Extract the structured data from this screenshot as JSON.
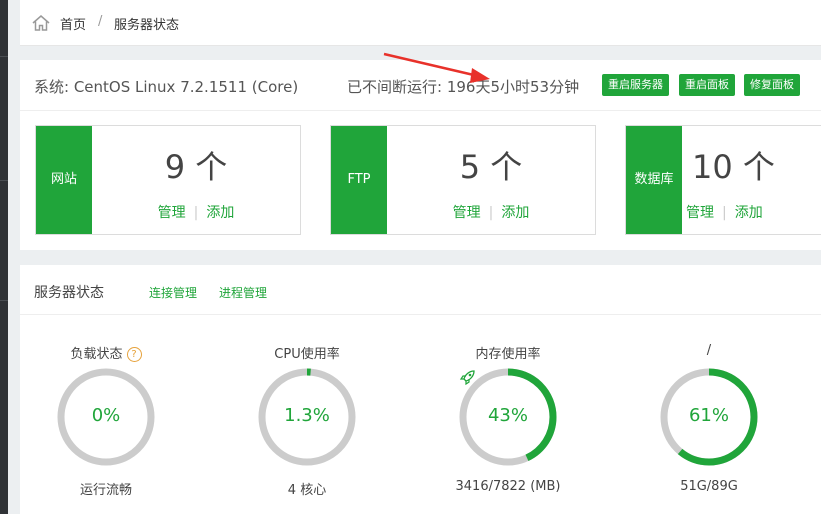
{
  "breadcrumb": {
    "home": "首页",
    "separator": "/",
    "current": "服务器状态"
  },
  "system": {
    "os_label": "系统: CentOS Linux 7.2.1511 (Core)",
    "uptime_label": "已不间断运行: 196天5小时53分钟",
    "buttons": [
      "重启服务器",
      "重启面板",
      "修复面板"
    ]
  },
  "cards": [
    {
      "tag": "网站",
      "count": "9 个",
      "manage": "管理",
      "add": "添加"
    },
    {
      "tag": "FTP",
      "count": "5 个",
      "manage": "管理",
      "add": "添加"
    },
    {
      "tag": "数据库",
      "count": "10 个",
      "manage": "管理",
      "add": "添加"
    }
  ],
  "status": {
    "title": "服务器状态",
    "links": [
      "连接管理",
      "进程管理"
    ],
    "gauges": [
      {
        "label": "负载状态",
        "value": "0%",
        "percent": 0,
        "sub": "运行流畅",
        "help_icon": "question-icon"
      },
      {
        "label": "CPU使用率",
        "value": "1.3%",
        "percent": 1.3,
        "sub": "4 核心"
      },
      {
        "label": "内存使用率",
        "value": "43%",
        "percent": 43,
        "sub": "3416/7822 (MB)",
        "icon": "rocket-icon"
      },
      {
        "label": "/",
        "value": "61%",
        "percent": 61,
        "sub": "51G/89G"
      }
    ]
  },
  "colors": {
    "accent": "#20a53a",
    "ring_track": "#cccccc",
    "annotation_arrow": "#e8312a"
  }
}
